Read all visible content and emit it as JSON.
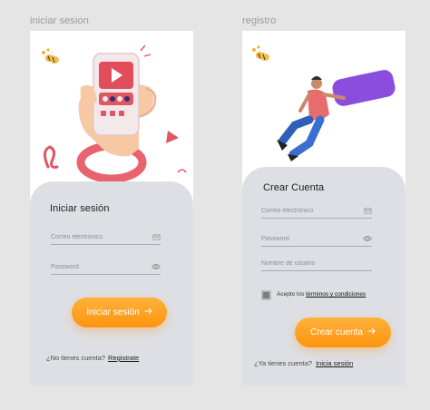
{
  "frames": {
    "login": {
      "title": "iniciar sesion"
    },
    "register": {
      "title": "registro"
    }
  },
  "login": {
    "heading": "Iniciar sesión",
    "email_placeholder": "Correo electrónico",
    "password_placeholder": "Password",
    "submit_label": "Iniciar sesión",
    "footer_text": "¿No tienes cuenta?",
    "footer_link": "Registrate"
  },
  "register": {
    "heading": "Crear Cuenta",
    "email_placeholder": "Correo electrónico",
    "password_placeholder": "Password",
    "username_placeholder": "Nombre de usuario",
    "terms_prefix": "Acepto los",
    "terms_link": "términos y condiciones",
    "submit_label": "Crear cuenta",
    "footer_text": "¿Ya tienes cuenta?",
    "footer_link": "Inicia sesión"
  },
  "colors": {
    "accent": "#ff9f1c",
    "card": "#dedfe4",
    "canvas": "#e5e5e5",
    "phone_red": "#e25563",
    "banner_purple": "#8b4ddd"
  },
  "icons": {
    "email": "envelope-icon",
    "password": "eye-icon",
    "submit": "arrow-right-icon",
    "logo": "bee-icon"
  }
}
